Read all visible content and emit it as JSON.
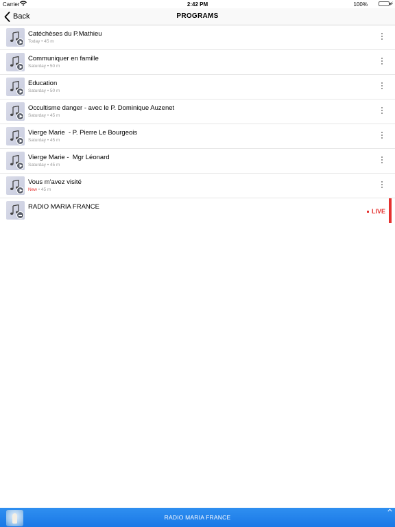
{
  "status_bar": {
    "carrier": "Carrier",
    "time": "2:42 PM",
    "battery": "100%",
    "battery_level": 1.0,
    "icons": [
      "wifi-icon",
      "battery-icon",
      "charging-icon"
    ]
  },
  "nav": {
    "back_label": "Back",
    "title": "PROGRAMS"
  },
  "programs": [
    {
      "title": "Catéchèses du P.Mathieu",
      "day": "Today",
      "duration": "45 m",
      "is_new": false
    },
    {
      "title": "Communiquer en famille",
      "day": "Saturday",
      "duration": "50 m",
      "is_new": false
    },
    {
      "title": "Education",
      "day": "Saturday",
      "duration": "50 m",
      "is_new": false
    },
    {
      "title": "Occultisme danger - avec le P. Dominique Auzenet",
      "day": "Saturday",
      "duration": "45 m",
      "is_new": false
    },
    {
      "title": "Vierge Marie  - P. Pierre Le Bourgeois",
      "day": "Saturday",
      "duration": "45 m",
      "is_new": false
    },
    {
      "title": "Vierge Marie -  Mgr Léonard",
      "day": "Saturday",
      "duration": "45 m",
      "is_new": false
    },
    {
      "title": "Vous m'avez visité",
      "day": "New",
      "duration": "45 m",
      "is_new": true
    }
  ],
  "meta_separator": " • ",
  "live_station": {
    "title": "RADIO MARIA FRANCE",
    "live_label": "LIVE"
  },
  "player": {
    "station": "RADIO MARIA FRANCE"
  },
  "colors": {
    "accent_red": "#e5312f",
    "player_blue": "#1f80ea",
    "battery_green": "#4cd964"
  }
}
